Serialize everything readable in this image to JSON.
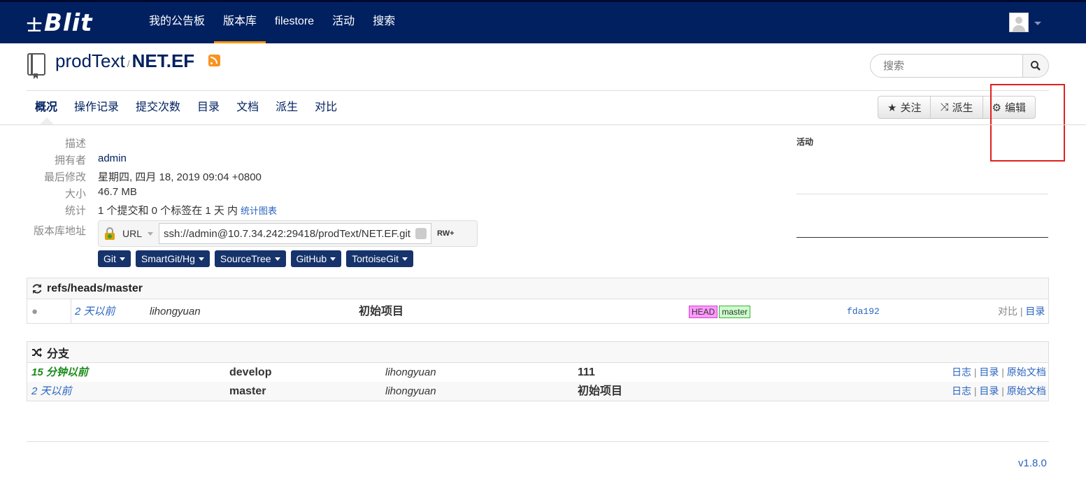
{
  "navbar": {
    "brand_prefix": "士",
    "brand": "Blit",
    "items": [
      {
        "label": "我的公告板",
        "active": false
      },
      {
        "label": "版本库",
        "active": true
      },
      {
        "label": "filestore",
        "active": false
      },
      {
        "label": "活动",
        "active": false
      },
      {
        "label": "搜索",
        "active": false
      }
    ]
  },
  "repo": {
    "project": "prodText",
    "separator": "/",
    "name": "NET.EF"
  },
  "search": {
    "placeholder": "搜索"
  },
  "tabs": [
    {
      "label": "概况",
      "active": true
    },
    {
      "label": "操作记录"
    },
    {
      "label": "提交次数"
    },
    {
      "label": "目录"
    },
    {
      "label": "文档"
    },
    {
      "label": "派生"
    },
    {
      "label": "对比"
    }
  ],
  "actions": {
    "watch": "关注",
    "fork": "派生",
    "edit": "编辑"
  },
  "meta": {
    "description_label": "描述",
    "owner_label": "拥有者",
    "owner": "admin",
    "last_modified_label": "最后修改",
    "last_modified": "星期四, 四月 18, 2019 09:04 +0800",
    "size_label": "大小",
    "size": "46.7 MB",
    "stats_label": "统计",
    "stats": "1 个提交和 0 个标签在 1 天 内",
    "stats_link": "统计图表",
    "url_label": "版本库地址",
    "url_type": "URL",
    "url": "ssh://admin@10.7.34.242:29418/prodText/NET.EF.git",
    "permission": "RW+"
  },
  "clients": [
    "Git",
    "SmartGit/Hg",
    "SourceTree",
    "GitHub",
    "TortoiseGit"
  ],
  "activity": {
    "title": "活动"
  },
  "refs": {
    "title": "refs/heads/master",
    "row": {
      "age": "2 天以前",
      "author": "lihongyuan",
      "message": "初始项目",
      "badges": [
        "HEAD",
        "master"
      ],
      "hash": "fda192",
      "link_compare": "对比",
      "link_tree": "目录"
    }
  },
  "branches": {
    "title": "分支",
    "rows": [
      {
        "age": "15 分钟以前",
        "name": "develop",
        "author": "lihongyuan",
        "message": "111",
        "log": "日志",
        "tree": "目录",
        "docs": "原始文档"
      },
      {
        "age": "2 天以前",
        "name": "master",
        "author": "lihongyuan",
        "message": "初始项目",
        "log": "日志",
        "tree": "目录",
        "docs": "原始文档"
      }
    ]
  },
  "footer": {
    "version": "v1.8.0"
  },
  "colors": {
    "navbar": "#002060",
    "active_tab_underline": "#ff9900",
    "recent_age": "#1a8a1a",
    "highlight": "#e02020"
  }
}
